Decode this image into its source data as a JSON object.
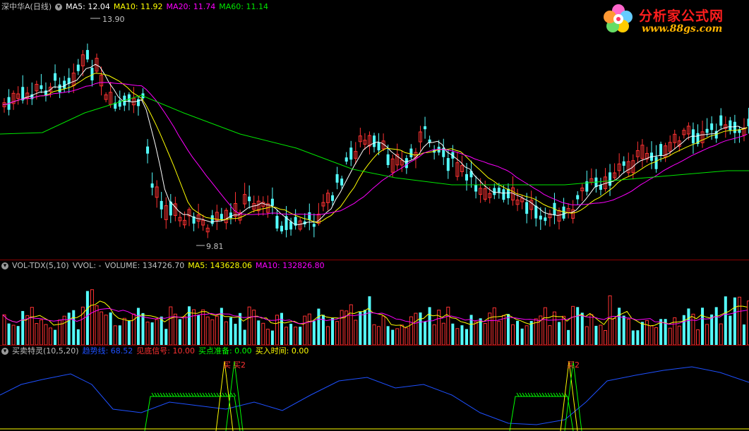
{
  "price_pane": {
    "title": "深中华A(日线)",
    "ma5": "MA5: 12.04",
    "ma10": "MA10: 11.92",
    "ma20": "MA20: 11.74",
    "ma60": "MA60: 11.14",
    "high_label": "13.90",
    "low_label": "9.81"
  },
  "volume_pane": {
    "indicator": "VOL-TDX(5,10)",
    "vvol": "VVOL: -",
    "volume": "VOLUME: 134726.70",
    "ma5": "MA5: 143628.06",
    "ma10": "MA10: 132826.80"
  },
  "indicator_pane": {
    "indicator": "买卖特灵(10,5,20)",
    "trend_label": "趋势线: 68.52",
    "bottom_signal": "见底信号: 10.00",
    "buy_prepare": "买点准备: 0.00",
    "buy_time": "买入时间: 0.00",
    "marker_buy": "买",
    "marker_buy2": "买2"
  },
  "logo": {
    "name": "分析家公式网",
    "url": "www.88gs.com"
  },
  "colors": {
    "up": "#ff3232",
    "down": "#54ffff",
    "ma5": "#ffffff",
    "ma10": "#ffff00",
    "ma20": "#ff00ff",
    "ma60": "#00e600",
    "trend": "#1e50ff",
    "signal": "#00ff00",
    "separator": "#8b0000"
  }
}
